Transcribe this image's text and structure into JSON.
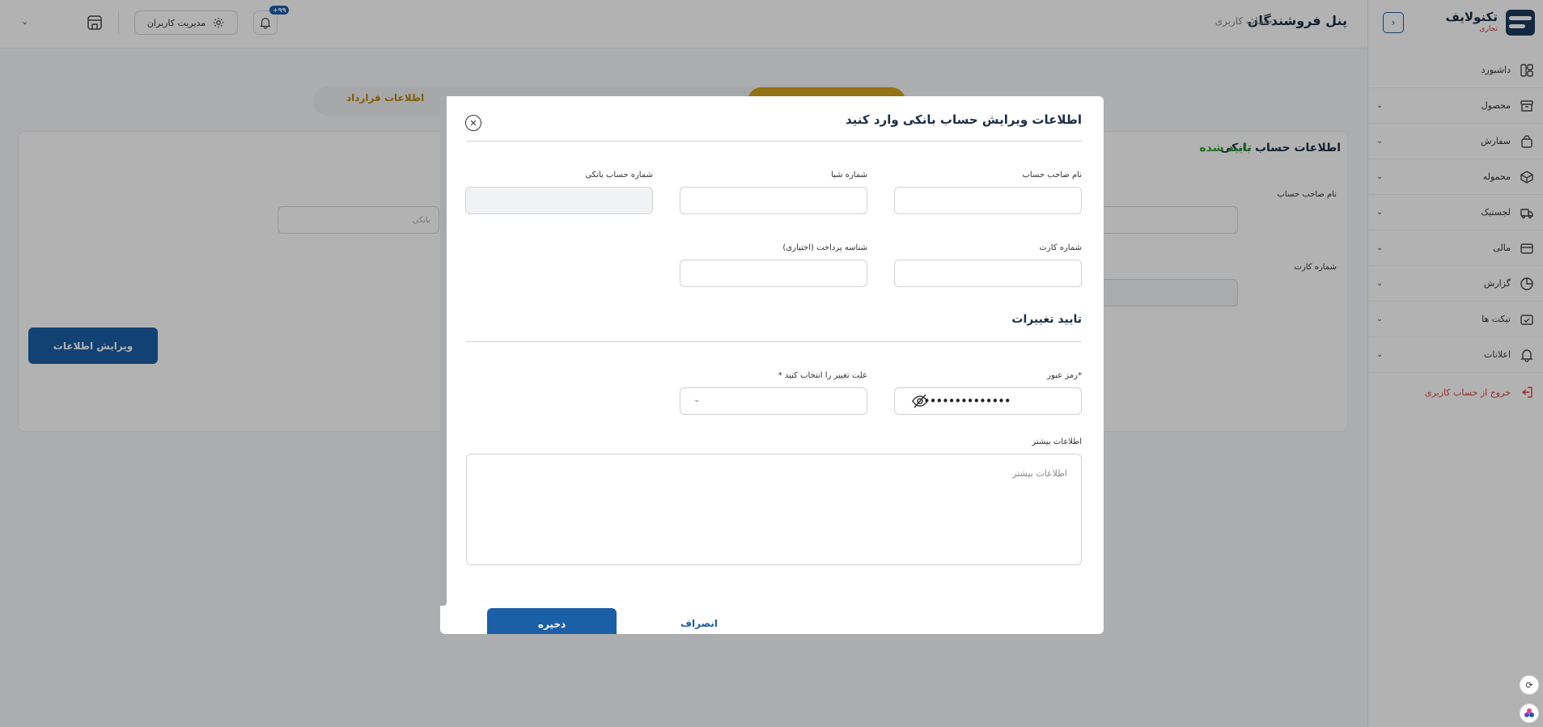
{
  "brand": {
    "name": "تکنولایف",
    "sub": "تجاری"
  },
  "header": {
    "title": "پنل فروشندگان",
    "breadcrumb": "حساب کاربری",
    "user_management": "مدیریت کاربران",
    "notification_badge": "۹۹+"
  },
  "sidebar": {
    "items": [
      {
        "label": "داشبورد",
        "icon": "dashboard-icon",
        "has_children": false
      },
      {
        "label": "محصول",
        "icon": "box-icon",
        "has_children": true
      },
      {
        "label": "سفارش",
        "icon": "bag-icon",
        "has_children": true
      },
      {
        "label": "محموله",
        "icon": "package-icon",
        "has_children": true
      },
      {
        "label": "لجستیک",
        "icon": "truck-icon",
        "has_children": true
      },
      {
        "label": "مالی",
        "icon": "wallet-icon",
        "has_children": true
      },
      {
        "label": "گزارش",
        "icon": "chart-icon",
        "has_children": true
      },
      {
        "label": "تیکت ها",
        "icon": "ticket-icon",
        "has_children": true
      },
      {
        "label": "اعلانات",
        "icon": "bell-icon",
        "has_children": true
      }
    ],
    "logout": "خروج از حساب کاربری"
  },
  "background": {
    "tab_contract": "اطلاعات قرارداد",
    "bank_title": "اطلاعات حساب بانکی",
    "bank_status": "تایید شده",
    "label_holder": "نام صاحب حساب",
    "label_card": "شماره کارت",
    "input_bank_placeholder": "بانکی",
    "edit_button": "ویرایش اطلاعات"
  },
  "modal": {
    "title": "اطلاعات ویرایش حساب بانکی وارد کنید",
    "fields": {
      "holder_name": "نام صاحب حساب",
      "sheba": "شماره شبا",
      "account_number": "شماره حساب بانکی",
      "card_number": "شماره کارت",
      "payment_id": "شناسه پرداخت (اختیاری)"
    },
    "confirm_title": "تایید تغییرات",
    "password_label": "*رمز عبور",
    "password_value": "••••••••••••••",
    "reason_label": "علت تغییر را انتخاب کنید *",
    "more_info_label": "اطلاعات بیشتر",
    "more_info_placeholder": "اطلاعات بیشتر",
    "save": "ذخیره",
    "cancel": "انصراف"
  },
  "colors": {
    "primary": "#1b5fa6",
    "success": "#37a13a",
    "danger": "#d9413d",
    "gold": "#d4a41c"
  }
}
